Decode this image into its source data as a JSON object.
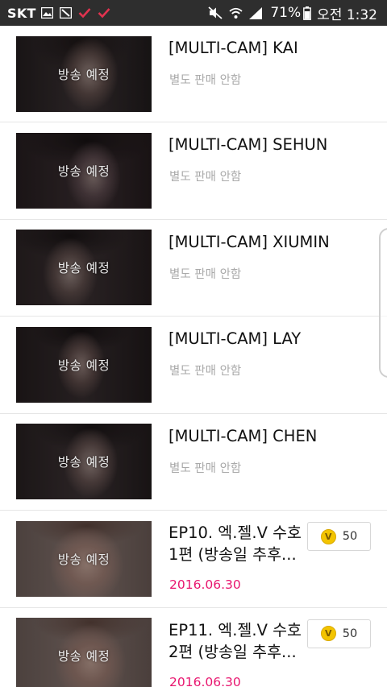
{
  "status_bar": {
    "carrier": "SKT",
    "battery": "71%",
    "time": "오전 1:32",
    "icons": [
      "gallery-icon",
      "image-icon",
      "check-icon",
      "check-icon",
      "mute-icon",
      "wifi-icon",
      "signal-icon",
      "battery-icon"
    ]
  },
  "items": [
    {
      "thumb_label": "방송 예정",
      "title": "[MULTI-CAM] KAI",
      "subtitle": "별도 판매 안함"
    },
    {
      "thumb_label": "방송 예정",
      "title": "[MULTI-CAM] SEHUN",
      "subtitle": "별도 판매 안함"
    },
    {
      "thumb_label": "방송 예정",
      "title": "[MULTI-CAM] XIUMIN",
      "subtitle": "별도 판매 안함"
    },
    {
      "thumb_label": "방송 예정",
      "title": "[MULTI-CAM] LAY",
      "subtitle": "별도 판매 안함"
    },
    {
      "thumb_label": "방송 예정",
      "title": "[MULTI-CAM] CHEN",
      "subtitle": "별도 판매 안함"
    },
    {
      "thumb_label": "방송 예정",
      "title": "EP10. 엑.젤.V 수호 1편 (방송일 추후...",
      "date": "2016.06.30",
      "coin_glyph": "V",
      "price": "50"
    },
    {
      "thumb_label": "방송 예정",
      "title": "EP11. 엑.젤.V 수호 2편 (방송일 추후...",
      "date": "2016.06.30",
      "coin_glyph": "V",
      "price": "50"
    }
  ],
  "colors": {
    "status_bar_bg": "#2e2e2e",
    "date_accent": "#e8166f",
    "coin": "#f3c400",
    "check_icon": "#e0334f"
  }
}
